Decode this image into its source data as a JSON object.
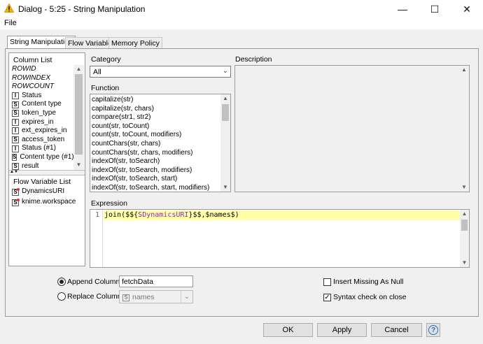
{
  "window": {
    "title": "Dialog - 5:25 - String Manipulation",
    "minimize_glyph": "—",
    "maximize_glyph": "☐",
    "close_glyph": "✕"
  },
  "menu": {
    "file": "File"
  },
  "tabs": [
    {
      "label": "String Manipulation",
      "active": true
    },
    {
      "label": "Flow Variables",
      "active": false
    },
    {
      "label": "Memory Policy",
      "active": false
    }
  ],
  "column_list": {
    "title": "Column List",
    "items": [
      {
        "label": "ROWID",
        "type": "",
        "italic": true
      },
      {
        "label": "ROWINDEX",
        "type": "",
        "italic": true
      },
      {
        "label": "ROWCOUNT",
        "type": "",
        "italic": true
      },
      {
        "label": "Status",
        "type": "I",
        "italic": false
      },
      {
        "label": "Content type",
        "type": "S",
        "italic": false
      },
      {
        "label": "token_type",
        "type": "S",
        "italic": false
      },
      {
        "label": "expires_in",
        "type": "I",
        "italic": false
      },
      {
        "label": "ext_expires_in",
        "type": "I",
        "italic": false
      },
      {
        "label": "access_token",
        "type": "S",
        "italic": false
      },
      {
        "label": "Status (#1)",
        "type": "I",
        "italic": false
      },
      {
        "label": "Content type (#1)",
        "type": "S",
        "italic": false
      },
      {
        "label": "result",
        "type": "S",
        "italic": false
      }
    ]
  },
  "flow_variable_list": {
    "title": "Flow Variable List",
    "items": [
      {
        "label": "DynamicsURI",
        "type": "S"
      },
      {
        "label": "knime.workspace",
        "type": "S"
      }
    ]
  },
  "category": {
    "label": "Category",
    "value": "All"
  },
  "function": {
    "label": "Function",
    "items": [
      "capitalize(str)",
      "capitalize(str, chars)",
      "compare(str1, str2)",
      "count(str, toCount)",
      "count(str, toCount, modifiers)",
      "countChars(str, chars)",
      "countChars(str, chars, modifiers)",
      "indexOf(str, toSearch)",
      "indexOf(str, toSearch, modifiers)",
      "indexOf(str, toSearch, start)",
      "indexOf(str, toSearch, start, modifiers)"
    ]
  },
  "description": {
    "label": "Description"
  },
  "expression": {
    "label": "Expression",
    "line_number": "1",
    "tokens": [
      {
        "text": "join(",
        "color": "#000000"
      },
      {
        "text": "$${",
        "color": "#000000"
      },
      {
        "text": "SDynamicsURI",
        "color": "#8b2ab8"
      },
      {
        "text": "}$$",
        "color": "#000000"
      },
      {
        "text": ",",
        "color": "#000000"
      },
      {
        "text": "$names$",
        "color": "#000000"
      },
      {
        "text": ")",
        "color": "#000000"
      }
    ]
  },
  "append_column": {
    "label": "Append Column:",
    "value": "fetchData",
    "selected": true
  },
  "replace_column": {
    "label": "Replace Column:",
    "value": "names",
    "type": "S",
    "selected": false
  },
  "insert_missing": {
    "label": "Insert Missing As Null",
    "checked": false
  },
  "syntax_check": {
    "label": "Syntax check on close",
    "checked": true
  },
  "buttons": {
    "ok": "OK",
    "apply": "Apply",
    "cancel": "Cancel",
    "help": "?"
  },
  "colors": {
    "accent_highlight": "#ffffa8",
    "warning_icon": "#f4b400",
    "help_blue": "#2b6fc2"
  }
}
